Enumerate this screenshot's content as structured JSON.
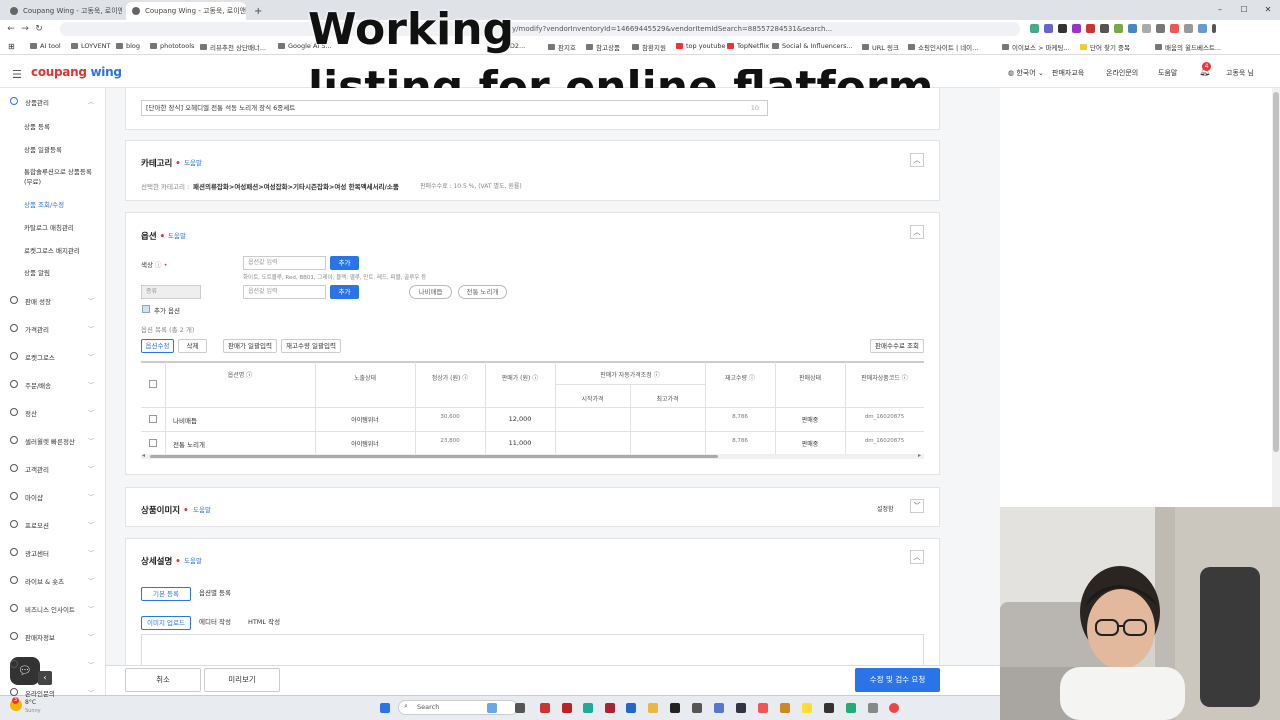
{
  "browser": {
    "tabs": [
      {
        "label": "Coupang Wing - 고동욱, 로이앤트"
      },
      {
        "label": "Coupang Wing - 고동욱, 로이앤"
      }
    ],
    "new_tab": "+",
    "window_controls": [
      "–",
      "☐",
      "✕"
    ],
    "url": "y/modify?vendorInventoryId=14669445529&vendorItemIdSearch=88557284531&search...",
    "bookmarks": [
      "AI tool",
      "LOYVENT",
      "blog",
      "phototools",
      "리뷰추천 상단배너...",
      "Google AI S...",
      "HD2...",
      "판지호",
      "참고상품",
      "참환지원",
      "top youtube",
      "TopNetflix",
      "Social & Influencers...",
      "URL 링크",
      "쇼핑인사이트 | 네이...",
      "이이보스 > 마케팅...",
      "단어 찾기 중복",
      "배움의 윌드베스트..."
    ]
  },
  "overlay": {
    "line1": "Working",
    "line2": "listing for online flatform"
  },
  "header": {
    "logo_part1": "coupang",
    "logo_part2": " wing",
    "language": "한국어",
    "links": [
      "판매자교육",
      "온라인문의",
      "도움말"
    ],
    "notification_count": "4",
    "user": "고동욱 님"
  },
  "sidebar": {
    "top": {
      "label": "상품관리"
    },
    "subitems": [
      {
        "label": "상품 등록",
        "active": false
      },
      {
        "label": "상품 일괄등록",
        "active": false
      },
      {
        "label": "통합솔루션으로 상품등록",
        "active": false
      },
      {
        "label": "(무료)",
        "active": false
      },
      {
        "label": "상품 조회/수정",
        "active": true
      },
      {
        "label": "카탈로그 매칭관리",
        "active": false
      },
      {
        "label": "로켓그로스 배지관리",
        "active": false
      },
      {
        "label": "상품 알림",
        "active": false
      }
    ],
    "items": [
      {
        "label": "판매 성장"
      },
      {
        "label": "가격관리"
      },
      {
        "label": "로켓그로스"
      },
      {
        "label": "주문/배송"
      },
      {
        "label": "정산"
      },
      {
        "label": "셀러월렛 빠른정산"
      },
      {
        "label": "고객관리"
      },
      {
        "label": "마이샵"
      },
      {
        "label": "프로모션"
      },
      {
        "label": "광고센터"
      },
      {
        "label": "라이브 & 숏츠"
      },
      {
        "label": "비즈니스 인사이트"
      },
      {
        "label": "판매자정보"
      },
      {
        "label": "...방"
      },
      {
        "label": "온라인문의"
      }
    ]
  },
  "product_name": {
    "value": "[단아한 장식] 오헤디엘 전통 석동 노리개 장식 6종세트",
    "counter": "10"
  },
  "category": {
    "title": "카테고리",
    "help": "도움말",
    "path_label": "선택한 카테고리 :",
    "path": "패션의류잡화>여성패션>여성잡화>기타시즌잡화>여성 한복액세서리/소품",
    "fee": "판매수수료 : 10.5 %, (VAT 별도, 원률)"
  },
  "options": {
    "title": "옵션",
    "help": "도움말",
    "attr_label": "색상",
    "attr_input_placeholder": "옵션값 입력",
    "add_label": "추가",
    "color_hint": "화이트, 도트블루, Red, BB01, 그레이, 블랙, 옐루, 민트, 레드, 피블, 골루우 등",
    "second_select": "종류",
    "second_input_placeholder": "옵션값 입력",
    "add2_label": "추가",
    "chips": [
      "나비매듭",
      "전통 노리개"
    ],
    "extra_option": "추가 옵션",
    "list_label": "옵션 목록 (총 2 개)",
    "buttons": [
      "옵션수정",
      "삭제",
      "판매가 일괄입력",
      "재고수량 일괄입력"
    ],
    "fee_lookup": "판매수수료 조회"
  },
  "table": {
    "headers": [
      "옵션명",
      "노출상태",
      "정상가 (원)",
      "판매가 (원)",
      "판매가 자동가격조정",
      "재고수량",
      "판매상태",
      "판매자상품코드"
    ],
    "subheaders": [
      "시작가격",
      "최고가격"
    ],
    "rows": [
      {
        "name": "나비매듭",
        "status": "아이템위너",
        "normal_price": "30,600",
        "sale_price": "12,000",
        "stock": "8,786",
        "sale_status": "판매중",
        "code": "dm_16020875"
      },
      {
        "name": "전통 노리개",
        "status": "아이템위너",
        "normal_price": "23,800",
        "sale_price": "11,000",
        "stock": "8,786",
        "sale_status": "판매중",
        "code": "dm_16020875"
      }
    ]
  },
  "images": {
    "title": "상품이미지",
    "help": "도움말",
    "state": "설정함"
  },
  "detail": {
    "title": "상세설명",
    "help": "도움말",
    "tabs": [
      "기본 등록",
      "옵션별 등록"
    ],
    "subtabs": [
      "이미지 업로드",
      "에디터 작성",
      "HTML 작성"
    ]
  },
  "bottom": {
    "cancel": "취소",
    "preview": "미리보기",
    "submit": "수정 및 검수 요청"
  },
  "taskbar": {
    "weather_temp": "8°C",
    "weather_desc": "Sunny",
    "search": "Search"
  }
}
